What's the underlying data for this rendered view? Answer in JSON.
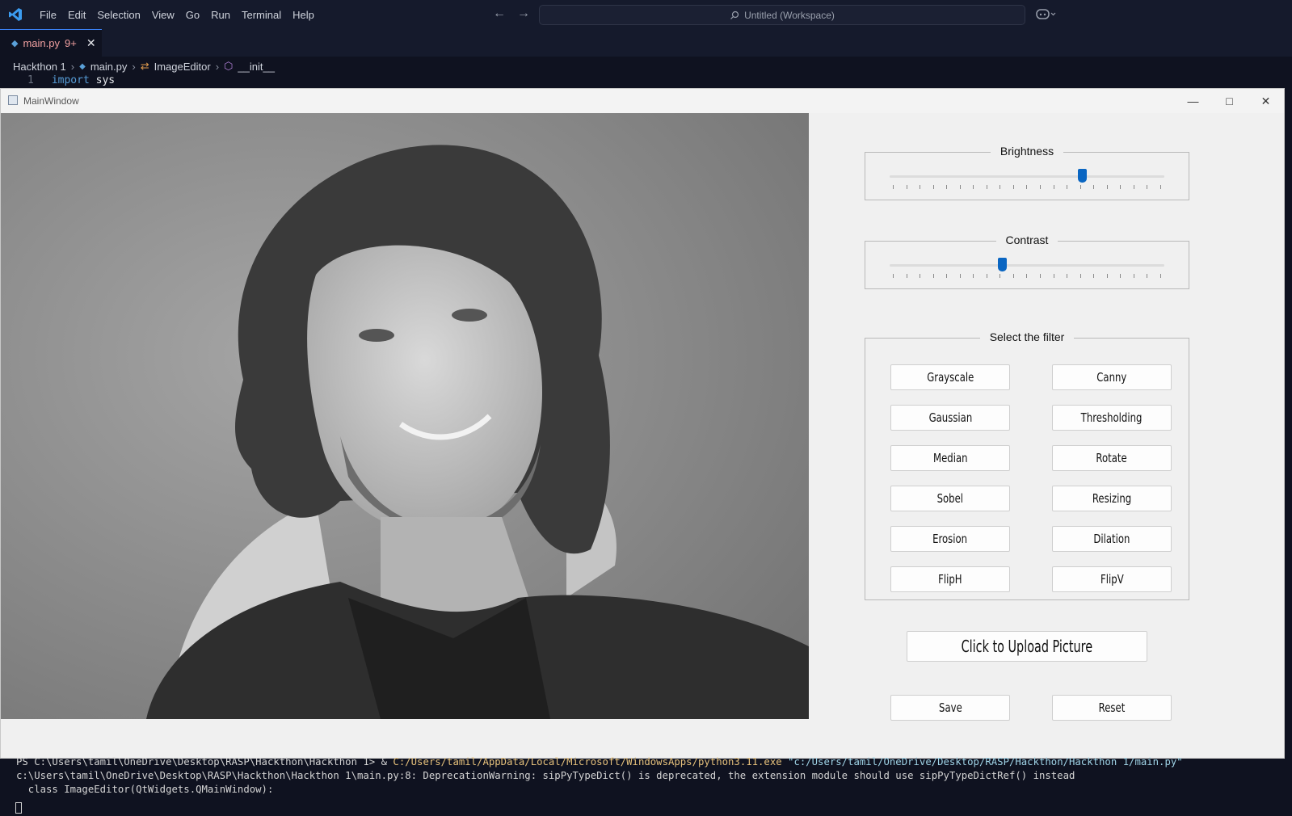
{
  "vscode": {
    "menu": [
      "File",
      "Edit",
      "Selection",
      "View",
      "Go",
      "Run",
      "Terminal",
      "Help"
    ],
    "search_text": "Untitled (Workspace)",
    "tab": {
      "filename": "main.py",
      "badge": "9+"
    },
    "breadcrumb": [
      "Hackthon 1",
      "main.py",
      "ImageEditor",
      "__init__"
    ],
    "code": {
      "line_number": "1",
      "keyword": "import",
      "identifier": "sys"
    }
  },
  "qt_window": {
    "title": "MainWindow",
    "brightness": {
      "label": "Brightness",
      "value_fraction": 0.7
    },
    "contrast": {
      "label": "Contrast",
      "value_fraction": 0.41
    },
    "filter_group": {
      "label": "Select the filter",
      "buttons": [
        "Grayscale",
        "Canny",
        "Gaussian",
        "Thresholding",
        "Median",
        "Rotate",
        "Sobel",
        "Resizing",
        "Erosion",
        "Dilation",
        "FlipH",
        "FlipV"
      ]
    },
    "upload_label": "Click to Upload Picture",
    "save_label": "Save",
    "reset_label": "Reset"
  },
  "terminal": {
    "line1_prefix": "PS C:\\Users\\tamil\\OneDrive\\Desktop\\RASP\\Hackthon\\Hackthon 1> & ",
    "line1_exe": "C:/Users/tamil/AppData/Local/Microsoft/WindowsApps/python3.11.exe",
    "line1_arg": " \"c:/Users/tamil/OneDrive/Desktop/RASP/Hackthon/Hackthon 1/main.py\"",
    "line2": "c:\\Users\\tamil\\OneDrive\\Desktop\\RASP\\Hackthon\\Hackthon 1\\main.py:8: DeprecationWarning: sipPyTypeDict() is deprecated, the extension module should use sipPyTypeDictRef() instead",
    "line3": "  class ImageEditor(QtWidgets.QMainWindow):"
  }
}
